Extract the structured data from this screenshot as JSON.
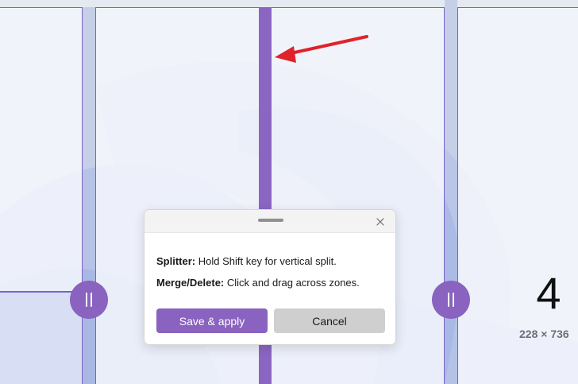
{
  "zone_editor": {
    "active_zone_number": "4",
    "active_zone_size": "228 × 736"
  },
  "dialog": {
    "tip_splitter_label": "Splitter:",
    "tip_splitter_text": " Hold Shift key for vertical split.",
    "tip_merge_label": "Merge/Delete:",
    "tip_merge_text": " Click and drag across zones.",
    "save_label": "Save & apply",
    "cancel_label": "Cancel"
  },
  "icons": {
    "close": "close-icon",
    "drag": "drag-handle-icon",
    "grip": "resize-grip-icon",
    "arrow": "red-arrow-annotation"
  },
  "colors": {
    "accent": "#8a62bf",
    "splitter": "#8a66c2",
    "zone_border": "#7b62c4",
    "annotation_arrow": "#e0222a"
  }
}
